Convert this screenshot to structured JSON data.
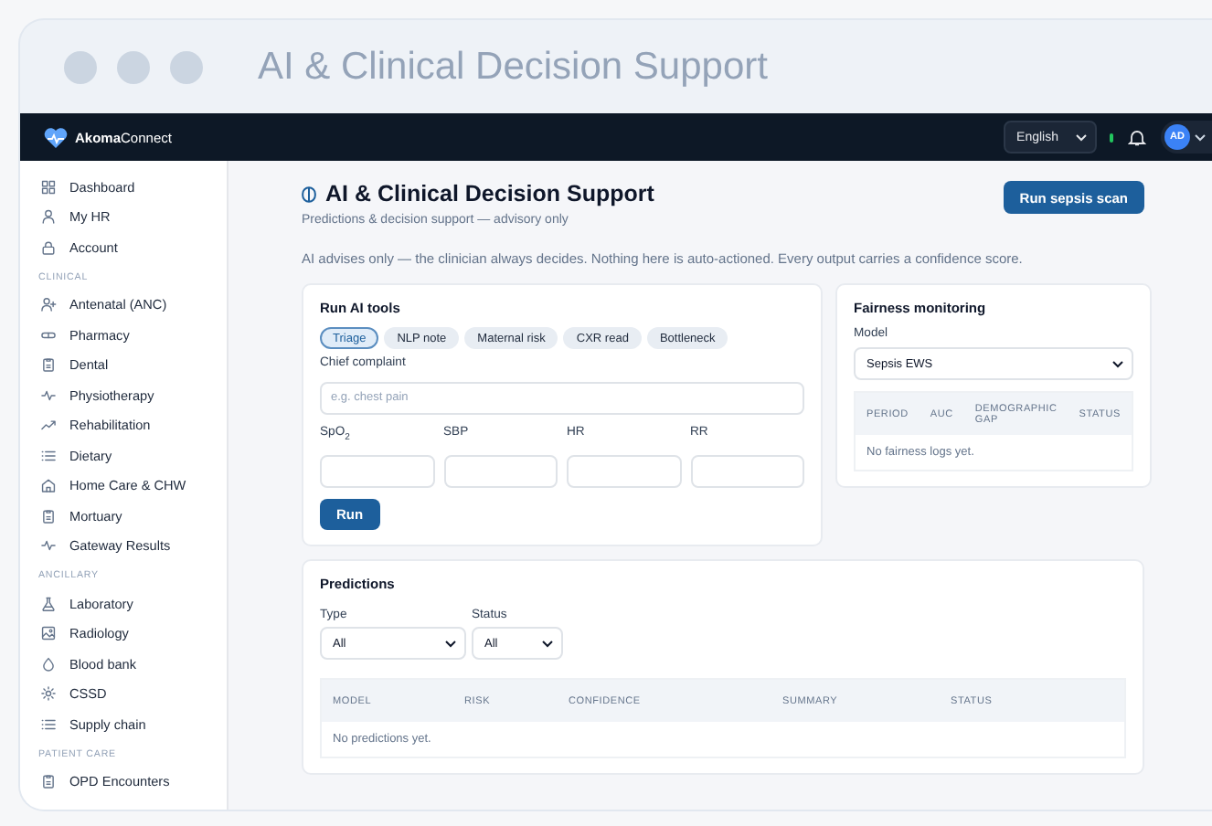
{
  "window": {
    "title": "AI & Clinical Decision Support"
  },
  "topbar": {
    "logo": "**Akoma**Connect",
    "language": "English",
    "online": true,
    "avatar": "AD"
  },
  "sidebar": {
    "sections": [
      {
        "items": [
          {
            "label": "Dashboard"
          },
          {
            "label": "My HR"
          },
          {
            "label": "Account"
          }
        ]
      },
      {
        "heading": "CLINICAL",
        "items": [
          {
            "label": "Antenatal (ANC)"
          },
          {
            "label": "Pharmacy"
          },
          {
            "label": "Dental"
          },
          {
            "label": "Physiotherapy"
          },
          {
            "label": "Rehabilitation"
          },
          {
            "label": "Dietary"
          },
          {
            "label": "Home Care & CHW"
          },
          {
            "label": "Mortuary"
          },
          {
            "label": "Gateway Results"
          }
        ]
      },
      {
        "heading": "ANCILLARY",
        "items": [
          {
            "label": "Laboratory"
          },
          {
            "label": "Radiology"
          },
          {
            "label": "Blood bank"
          },
          {
            "label": "CSSD"
          },
          {
            "label": "Supply chain"
          }
        ]
      },
      {
        "heading": "PATIENT CARE",
        "items": [
          {
            "label": "OPD Encounters"
          }
        ]
      }
    ]
  },
  "page": {
    "title": "AI & Clinical Decision Support",
    "subtitle": "Predictions & decision support — advisory only",
    "action": "Run sepsis scan",
    "notice": "AI advises only — the clinician always decides. Nothing here is auto-actioned. Every output carries a confidence score."
  },
  "run_tools": {
    "title": "Run AI tools",
    "tools": [
      {
        "label": "Triage",
        "selected": true
      },
      {
        "label": "NLP note",
        "selected": false
      },
      {
        "label": "Maternal risk",
        "selected": false
      },
      {
        "label": "CXR read",
        "selected": false
      },
      {
        "label": "Bottleneck",
        "selected": false
      }
    ],
    "complaint": {
      "label": "Chief complaint",
      "placeholder": "e.g. chest pain"
    },
    "vitals": [
      {
        "label": "SpO$_{2}$"
      },
      {
        "label": "SBP"
      },
      {
        "label": "HR"
      },
      {
        "label": "RR"
      }
    ],
    "button": "Run"
  },
  "fairness": {
    "title": "Fairness monitoring",
    "model_label": "Model",
    "model": "Sepsis EWS",
    "columns": [
      "PERIOD",
      "AUC",
      "DEMOGRAPHIC GAP",
      "STATUS"
    ],
    "empty": "No fairness logs yet."
  },
  "predictions": {
    "title": "Predictions",
    "filters": [
      {
        "label": "Type",
        "value": "All"
      },
      {
        "label": "Status",
        "value": "All"
      }
    ],
    "columns": [
      "MODEL",
      "RISK",
      "CONFIDENCE",
      "SUMMARY",
      "STATUS"
    ],
    "empty": "No predictions yet."
  }
}
